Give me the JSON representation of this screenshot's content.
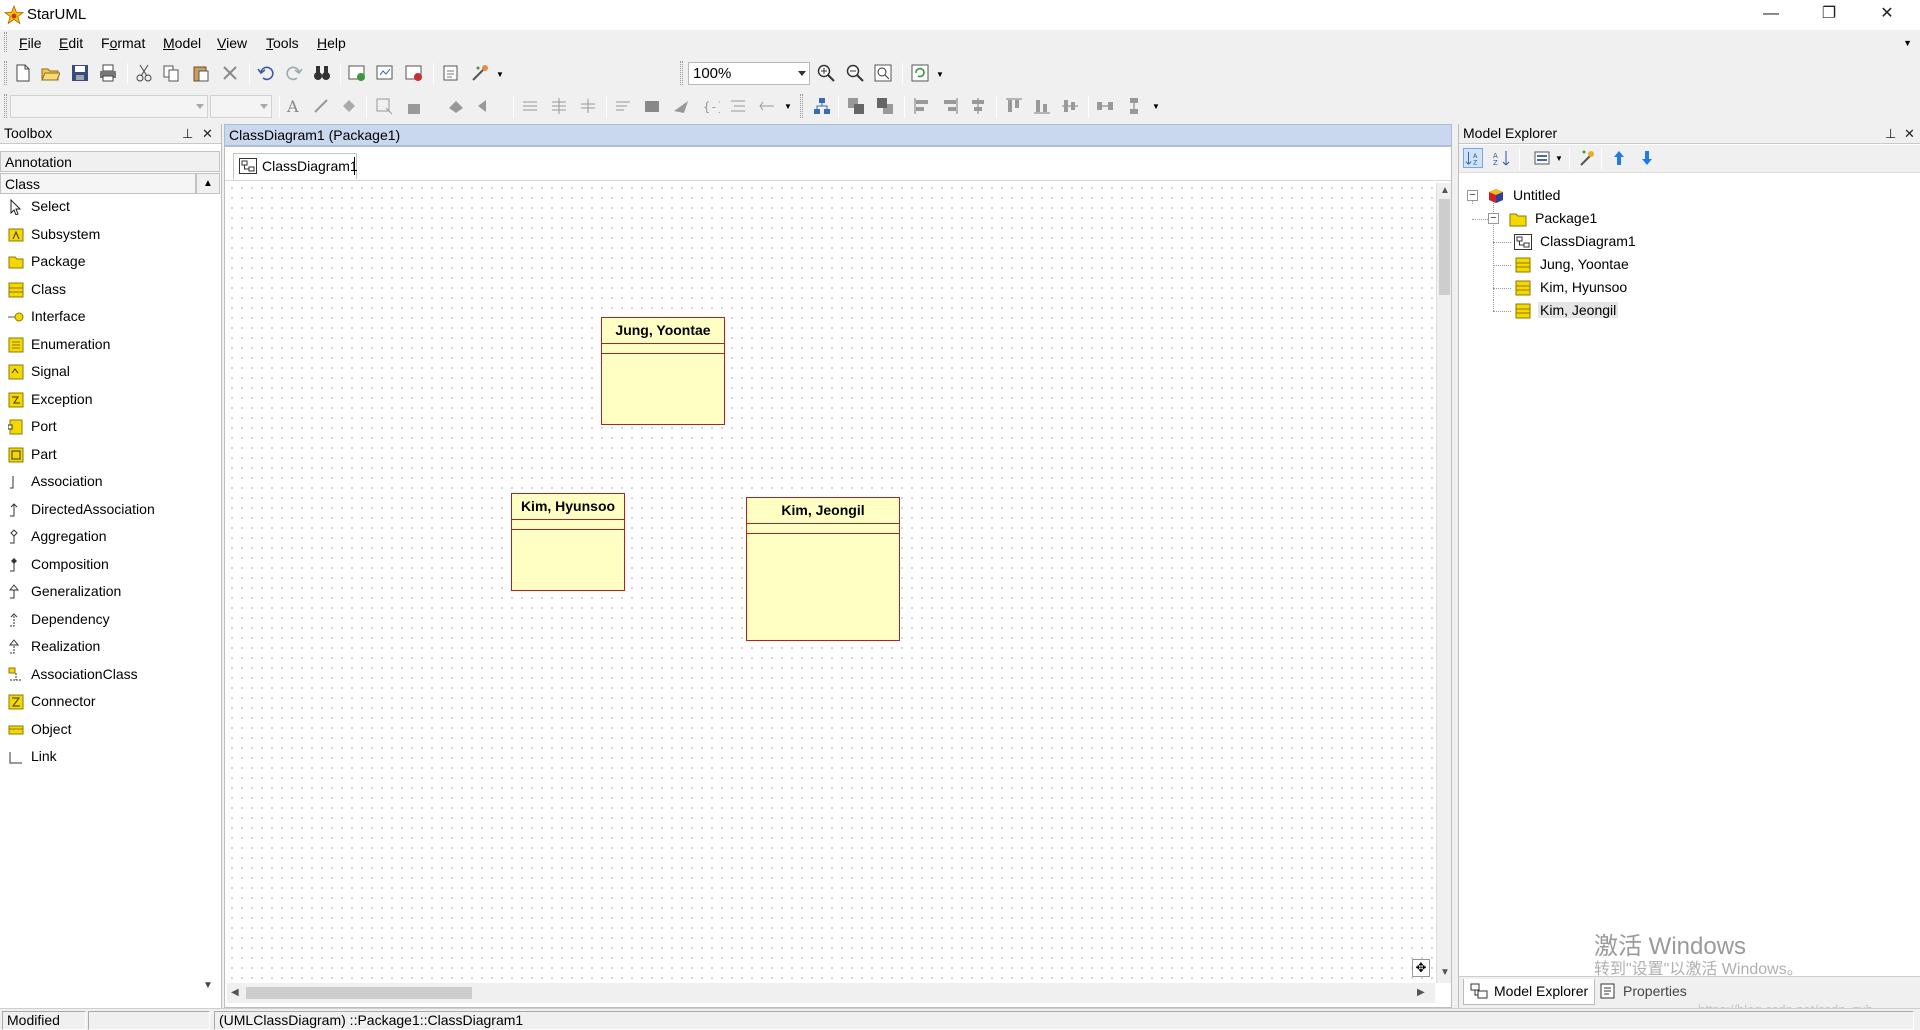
{
  "window": {
    "title": "StarUML",
    "controls": {
      "minimize": "—",
      "restore": "❐",
      "close": "✕"
    }
  },
  "menu": {
    "items": [
      {
        "key": "F",
        "rest": "ile"
      },
      {
        "key": "E",
        "rest": "dit"
      },
      {
        "key": "F",
        "rest": "ormat",
        "pre": ""
      },
      {
        "key": "M",
        "rest": "odel"
      },
      {
        "key": "V",
        "rest": "iew"
      },
      {
        "key": "T",
        "rest": "ools"
      },
      {
        "key": "H",
        "rest": "elp"
      }
    ],
    "overflow": "▼"
  },
  "toolbar": {
    "zoom": "100%",
    "font_name": "",
    "font_size": ""
  },
  "toolbox": {
    "title": "Toolbox",
    "pin": "📌",
    "close": "✕",
    "categories": {
      "annotation": "Annotation",
      "class": "Class"
    },
    "items": [
      {
        "label": "Select",
        "icon": "pointer-icon"
      },
      {
        "label": "Subsystem",
        "icon": "subsystem-icon"
      },
      {
        "label": "Package",
        "icon": "package-icon"
      },
      {
        "label": "Class",
        "icon": "class-icon"
      },
      {
        "label": "Interface",
        "icon": "interface-icon"
      },
      {
        "label": "Enumeration",
        "icon": "enumeration-icon"
      },
      {
        "label": "Signal",
        "icon": "signal-icon"
      },
      {
        "label": "Exception",
        "icon": "exception-icon"
      },
      {
        "label": "Port",
        "icon": "port-icon"
      },
      {
        "label": "Part",
        "icon": "part-icon"
      },
      {
        "label": "Association",
        "icon": "association-icon"
      },
      {
        "label": "DirectedAssociation",
        "icon": "directed-association-icon"
      },
      {
        "label": "Aggregation",
        "icon": "aggregation-icon"
      },
      {
        "label": "Composition",
        "icon": "composition-icon"
      },
      {
        "label": "Generalization",
        "icon": "generalization-icon"
      },
      {
        "label": "Dependency",
        "icon": "dependency-icon"
      },
      {
        "label": "Realization",
        "icon": "realization-icon"
      },
      {
        "label": "AssociationClass",
        "icon": "association-class-icon"
      },
      {
        "label": "Connector",
        "icon": "connector-icon"
      },
      {
        "label": "Object",
        "icon": "object-icon"
      },
      {
        "label": "Link",
        "icon": "link-icon"
      }
    ]
  },
  "diagram": {
    "header": "ClassDiagram1 (Package1)",
    "tab": "ClassDiagram1",
    "classes": [
      {
        "name": "Jung, Yoontae"
      },
      {
        "name": "Kim, Hyunsoo"
      },
      {
        "name": "Kim, Jeongil"
      }
    ]
  },
  "model_explorer": {
    "title": "Model Explorer",
    "tree": {
      "root": "Untitled",
      "package": "Package1",
      "children": [
        "ClassDiagram1",
        "Jung, Yoontae",
        "Kim, Hyunsoo",
        "Kim, Jeongil"
      ]
    },
    "tabs": {
      "explorer": "Model Explorer",
      "properties": "Properties"
    }
  },
  "watermark": {
    "line1": "激活 Windows",
    "line2": "转到\"设置\"以激活 Windows。",
    "url": "https://blog.csdn.net/csdn_zxh"
  },
  "status": {
    "state": "Modified",
    "empty": "",
    "path": "(UMLClassDiagram) ::Package1::ClassDiagram1"
  },
  "colors": {
    "class_fill": "#ffffc4",
    "class_border": "#b22222",
    "diagram_header": "#c9d8ee"
  }
}
